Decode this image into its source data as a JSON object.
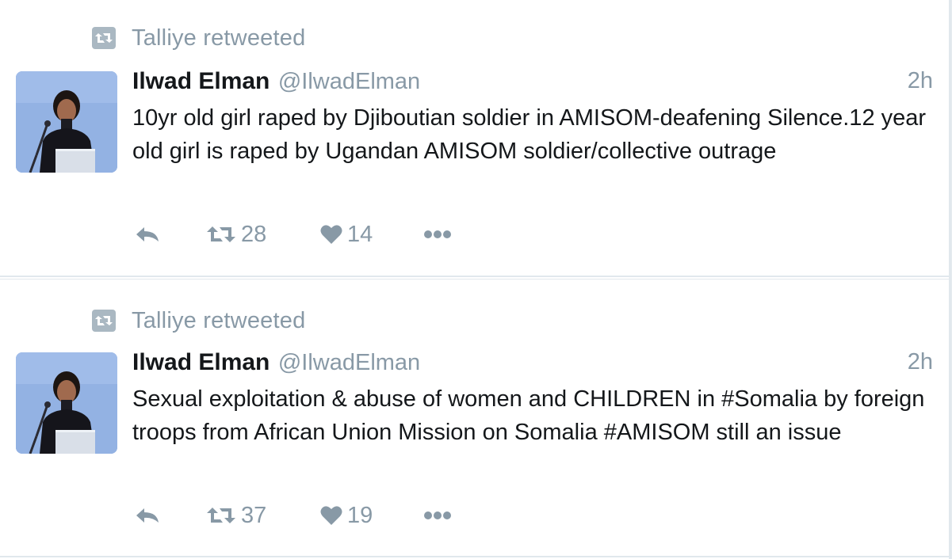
{
  "colors": {
    "muted": "#8899a6",
    "text": "#14171a",
    "divider": "#e1e8ed",
    "badge": "#aab8c2"
  },
  "tweets": [
    {
      "retweeted_by": "Talliye retweeted",
      "fullname": "Ilwad Elman",
      "username": "@IlwadElman",
      "time": "2h",
      "text": "10yr old girl raped by Djiboutian soldier in AMISOM-deafening Silence.12 year old girl is raped by Ugandan AMISOM soldier/collective outrage",
      "retweet_count": "28",
      "like_count": "14",
      "icons": {
        "reply": "reply-icon",
        "retweet": "retweet-icon",
        "like": "heart-icon",
        "more": "more-icon"
      }
    },
    {
      "retweeted_by": "Talliye retweeted",
      "fullname": "Ilwad Elman",
      "username": "@IlwadElman",
      "time": "2h",
      "text": "Sexual exploitation & abuse of women and CHILDREN in #Somalia by foreign troops from African Union Mission on Somalia #AMISOM still an issue",
      "retweet_count": "37",
      "like_count": "19",
      "icons": {
        "reply": "reply-icon",
        "retweet": "retweet-icon",
        "like": "heart-icon",
        "more": "more-icon"
      }
    }
  ]
}
